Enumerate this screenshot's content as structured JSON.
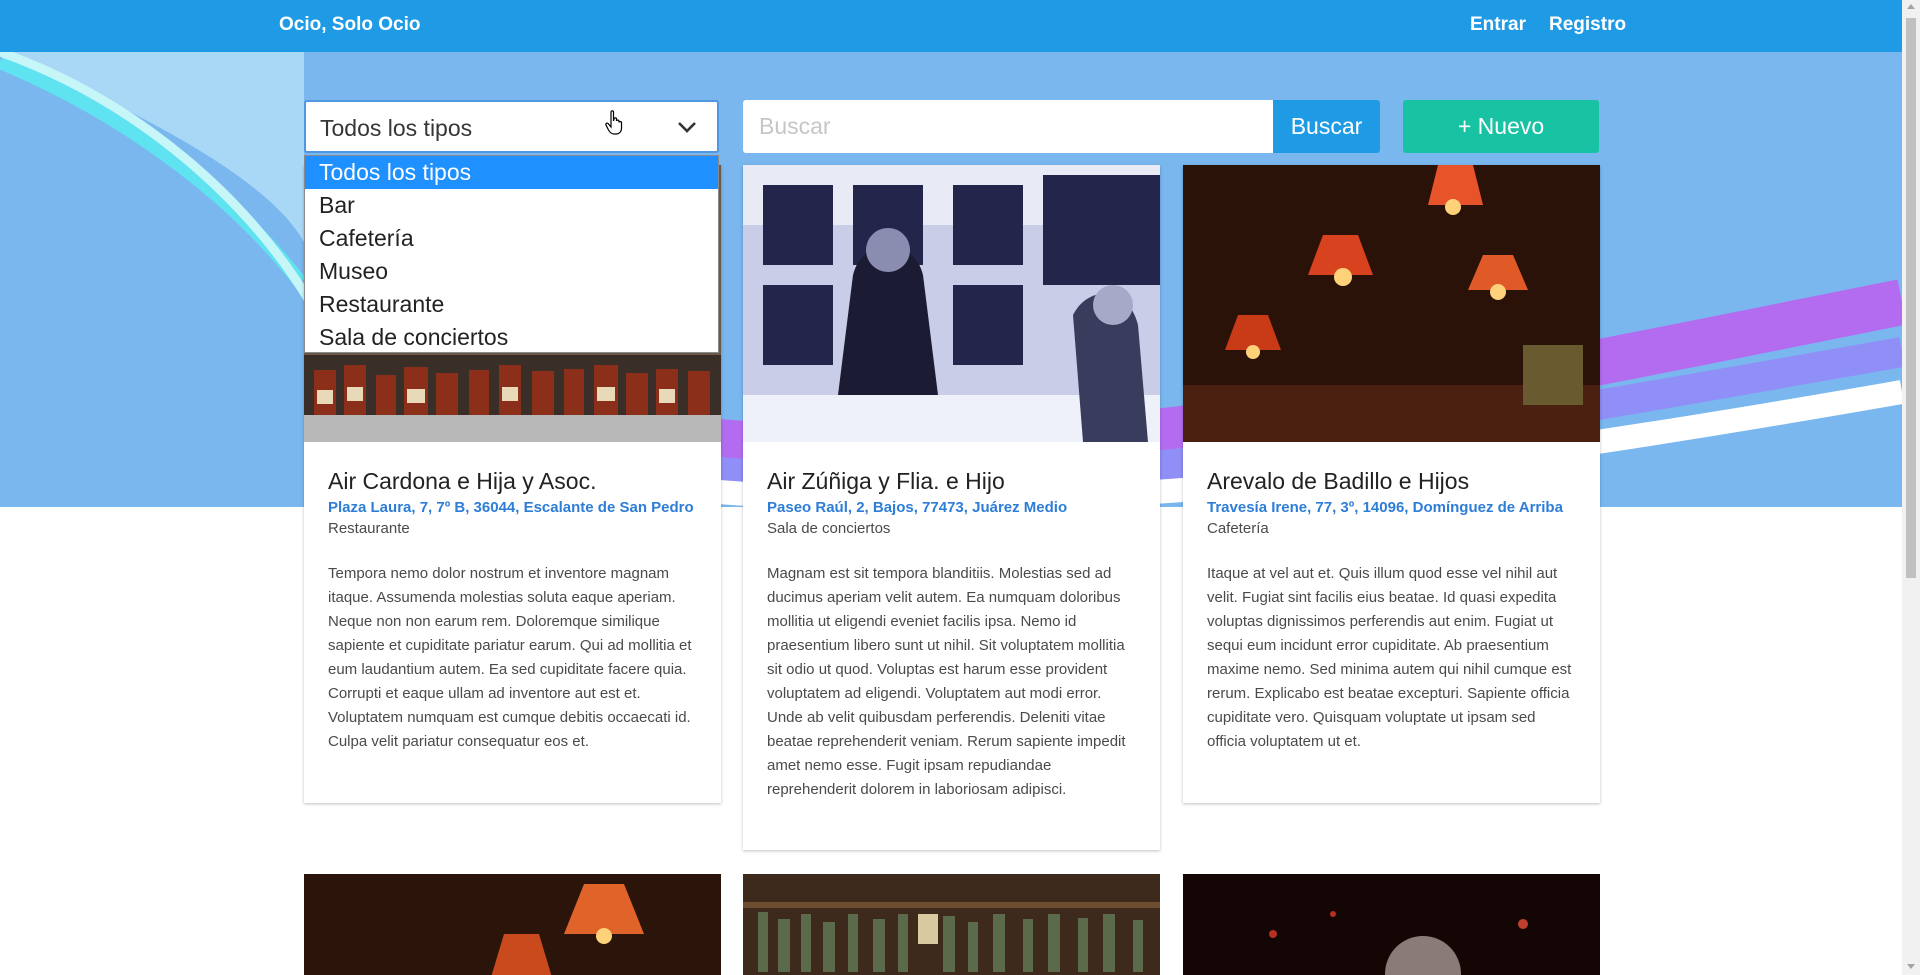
{
  "navbar": {
    "brand": "Ocio, Solo Ocio",
    "links": [
      "Entrar",
      "Registro"
    ]
  },
  "filters": {
    "type_select": {
      "selected": "Todos los tipos",
      "options": [
        "Todos los tipos",
        "Bar",
        "Cafetería",
        "Museo",
        "Restaurante",
        "Sala de conciertos"
      ]
    },
    "search": {
      "placeholder": "Buscar",
      "value": ""
    },
    "search_button": "Buscar",
    "new_button": "+ Nuevo"
  },
  "colors": {
    "primary": "#1f9be6",
    "success": "#18c3a3",
    "link": "#2e7dd6"
  },
  "places": [
    {
      "name": "Air Cardona e Hija y Asoc.",
      "address": "Plaza Laura, 7, 7º B, 36044, Escalante de San Pedro",
      "type": "Restaurante",
      "description": "Tempora nemo dolor nostrum et inventore magnam itaque. Assumenda molestias soluta eaque aperiam. Neque non non earum rem. Doloremque similique sapiente et cupiditate pariatur earum. Qui ad mollitia et eum laudantium autem. Ea sed cupiditate facere quia. Corrupti et eaque ullam ad inventore aut est et. Voluptatem numquam est cumque debitis occaecati id. Culpa velit pariatur consequatur eos et."
    },
    {
      "name": "Air Zúñiga y Flia. e Hijo",
      "address": "Paseo Raúl, 2, Bajos, 77473, Juárez Medio",
      "type": "Sala de conciertos",
      "description": "Magnam est sit tempora blanditiis. Molestias sed ad ducimus aperiam velit autem. Ea numquam doloribus mollitia ut eligendi eveniet facilis ipsa. Nemo id praesentium libero sunt ut nihil. Sit voluptatem mollitia sit odio ut quod. Voluptas est harum esse provident voluptatem ad eligendi. Voluptatem aut modi error. Unde ab velit quibusdam perferendis. Deleniti vitae beatae reprehenderit veniam. Rerum sapiente impedit amet nemo esse. Fugit ipsam repudiandae reprehenderit dolorem in laboriosam adipisci."
    },
    {
      "name": "Arevalo de Badillo e Hijos",
      "address": "Travesía Irene, 77, 3º, 14096, Domínguez de Arriba",
      "type": "Cafetería",
      "description": "Itaque at vel aut et. Quis illum quod esse vel nihil aut velit. Fugiat sint facilis eius beatae. Id quasi expedita voluptas dignissimos perferendis aut enim. Fugiat ut sequi eum incidunt error cupiditate. Ab praesentium maxime nemo. Sed minima autem qui nihil cumque est rerum. Explicabo est beatae excepturi. Sapiente officia cupiditate vero. Quisquam voluptate ut ipsam sed officia voluptatem ut et."
    }
  ]
}
